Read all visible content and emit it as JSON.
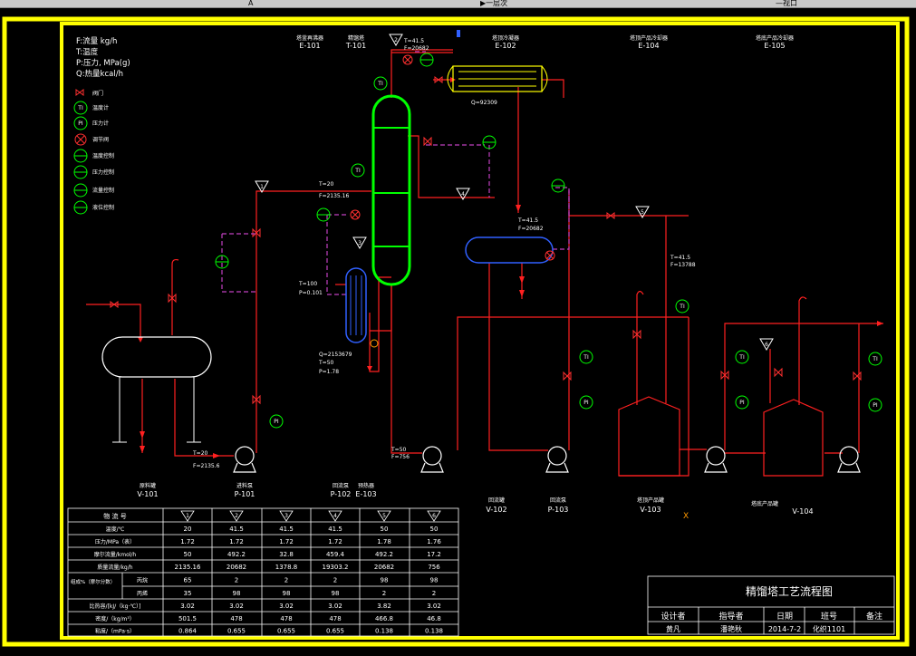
{
  "toolbar": {
    "left_text": "A",
    "mid_text": "▶一层次",
    "right_text": "—视口"
  },
  "legend": {
    "units": [
      "F:流量 kg/h",
      "T:温度",
      "P:压力, MPa(g)",
      "Q:热量kcal/h"
    ],
    "items": [
      {
        "symbol": "valve",
        "label": "阀门"
      },
      {
        "symbol": "TI",
        "label": "温度计"
      },
      {
        "symbol": "PI",
        "label": "压力计"
      },
      {
        "symbol": "cross",
        "label": "调节阀"
      },
      {
        "symbol": "ctrl",
        "label": "温度控制"
      },
      {
        "symbol": "ctrl",
        "label": "压力控制"
      },
      {
        "symbol": "ctrl",
        "label": "流量控制"
      },
      {
        "symbol": "ctrl",
        "label": "液位控制"
      }
    ]
  },
  "equipment_top": [
    {
      "name": "塔釜再沸器",
      "tag": "E-101"
    },
    {
      "name": "精馏塔",
      "tag": "T-101"
    },
    {
      "name": "塔顶冷凝器",
      "tag": "E-102"
    },
    {
      "name": "塔顶产品冷却器",
      "tag": "E-104"
    },
    {
      "name": "塔底产品冷却器",
      "tag": "E-105"
    }
  ],
  "equipment_bottom": [
    {
      "name": "原料罐",
      "tag": "V-101"
    },
    {
      "name": "进料泵",
      "tag": "P-101"
    },
    {
      "name": "回流泵",
      "tag": "P-102"
    },
    {
      "name": "预热器",
      "tag": "E-103"
    },
    {
      "name": "回流罐",
      "tag": "V-102"
    },
    {
      "name": "回流泵",
      "tag": "P-103"
    },
    {
      "name": "塔顶产品罐",
      "tag": "V-103"
    },
    {
      "name": "塔底产品罐",
      "tag": "V-104"
    }
  ],
  "annotations": {
    "top_T": "T=41.5",
    "top_F": "F=20682",
    "Q_cond": "Q=92309",
    "feed_T": "T=20",
    "feed_F": "F=2135.16",
    "reb_T": "T=100",
    "reb_P": "P=0.101",
    "preheat_Q": "Q=2153679",
    "preheat_T": "T=50",
    "preheat_P": "P=1.78",
    "drum_T": "T=41.5",
    "drum_F": "F=20682",
    "dist_T": "T=41.5",
    "dist_F": "F=13788",
    "pump_T": "T=20",
    "pump_F": "F=2135.6",
    "bot_T": "T=50",
    "bot_F": "F=756",
    "stream_marks": [
      "1",
      "2",
      "3",
      "4",
      "5",
      "6"
    ],
    "x_mark": "X"
  },
  "stream_table": {
    "header": "物 流 号",
    "columns": [
      "1",
      "2",
      "3",
      "4",
      "5",
      "6"
    ],
    "rows": [
      {
        "label": "温度/℃",
        "values": [
          "20",
          "41.5",
          "41.5",
          "41.5",
          "50",
          "50"
        ]
      },
      {
        "label": "压力/MPa（表）",
        "values": [
          "1.72",
          "1.72",
          "1.72",
          "1.72",
          "1.78",
          "1.76"
        ]
      },
      {
        "label": "摩尔流量/kmol/h",
        "values": [
          "50",
          "492.2",
          "32.8",
          "459.4",
          "492.2",
          "17.2"
        ]
      },
      {
        "label": "质量流量/kg/h",
        "values": [
          "2135.16",
          "20682",
          "1378.8",
          "19303.2",
          "20682",
          "756"
        ]
      },
      {
        "label": "组成%（摩尔分数）",
        "sub": "丙烷",
        "values": [
          "65",
          "2",
          "2",
          "2",
          "98",
          "98"
        ]
      },
      {
        "label": "",
        "sub": "丙烯",
        "values": [
          "35",
          "98",
          "98",
          "98",
          "2",
          "2"
        ]
      },
      {
        "label": "比热容/[kJ/（kg·℃）]",
        "values": [
          "3.02",
          "3.02",
          "3.02",
          "3.02",
          "3.82",
          "3.02"
        ]
      },
      {
        "label": "密度/（kg/m³）",
        "values": [
          "501.5",
          "478",
          "478",
          "478",
          "466.8",
          "46.8"
        ]
      },
      {
        "label": "粘度/（mPa·s）",
        "values": [
          "0.864",
          "0.655",
          "0.655",
          "0.655",
          "0.138",
          "0.138"
        ]
      }
    ]
  },
  "title_block": {
    "title": "精馏塔工艺流程图",
    "headers": [
      "设计者",
      "指导者",
      "日期",
      "班号",
      "备注"
    ],
    "values": [
      "黄凡",
      "潘艳秋",
      "2014-7-2",
      "化织1101",
      ""
    ]
  },
  "colors": {
    "frame": "#ffff00",
    "pipe": "#ff2020",
    "signal": "#c040c0",
    "column": "#00ff00",
    "text": "#ffffff",
    "instrument": "#00ff00",
    "vessel": "#00ffff"
  }
}
